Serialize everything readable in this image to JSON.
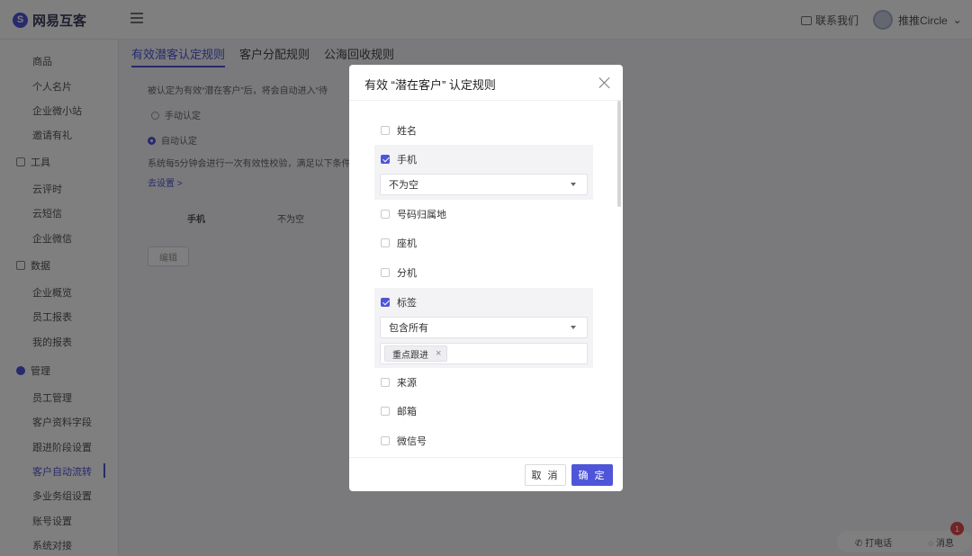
{
  "app": {
    "brand": "网易互客",
    "contact_label": "联系我们",
    "user_name": "推推Circle"
  },
  "sidebar": {
    "items_top": [
      "商品",
      "个人名片",
      "企业微小站",
      "邀请有礼"
    ],
    "groups": [
      {
        "label": "工具",
        "items": [
          "云评时",
          "云短信",
          "企业微信"
        ]
      },
      {
        "label": "数据",
        "items": [
          "企业概览",
          "员工报表",
          "我的报表"
        ]
      },
      {
        "label": "管理",
        "items": [
          "员工管理",
          "客户资料字段",
          "跟进阶段设置",
          "客户自动流转",
          "多业务组设置",
          "账号设置",
          "系统对接"
        ]
      }
    ],
    "active_item": "客户自动流转"
  },
  "main": {
    "tabs": [
      "有效潜客认定规则",
      "客户分配规则",
      "公海回收规则"
    ],
    "desc": "被认定为有效“潜在客户”后，将会自动进入“待",
    "radio_manual": "手动认定",
    "radio_auto": "自动认定",
    "auto_desc": "系统每5分钟会进行一次有效性校验，满足以下条件",
    "settings_link": "去设置 >",
    "table_col1": "手机",
    "table_col2": "不为空",
    "edit_button": "编辑"
  },
  "float_tools": {
    "call": "打电话",
    "message": "消息",
    "badge_count": "1"
  },
  "modal": {
    "title": "有效 “潜在客户” 认定规则",
    "fields": {
      "name": "姓名",
      "phone": "手机",
      "phone_condition": "不为空",
      "region": "号码归属地",
      "landline": "座机",
      "extension": "分机",
      "tag": "标签",
      "tag_condition": "包含所有",
      "tag_value": "重点跟进",
      "source": "来源",
      "email": "邮箱",
      "wechat": "微信号"
    },
    "cancel_label": "取 消",
    "ok_label": "确 定"
  },
  "colors": {
    "accent": "#4f55d8",
    "overlay": "rgba(0,0,0,0.5)"
  }
}
